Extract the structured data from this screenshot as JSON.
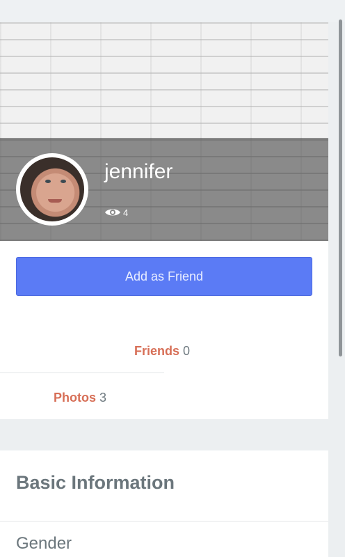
{
  "profile": {
    "name": "jennifer",
    "views": "4",
    "add_friend_label": "Add as Friend"
  },
  "stats": {
    "friends_label": "Friends",
    "friends_count": "0",
    "photos_label": "Photos",
    "photos_count": "3"
  },
  "basic_info": {
    "title": "Basic Information",
    "fields": [
      "Gender"
    ]
  },
  "icons": {
    "views": "eye-icon"
  },
  "colors": {
    "accent": "#5b7bf5",
    "stat_label": "#d76f57"
  }
}
